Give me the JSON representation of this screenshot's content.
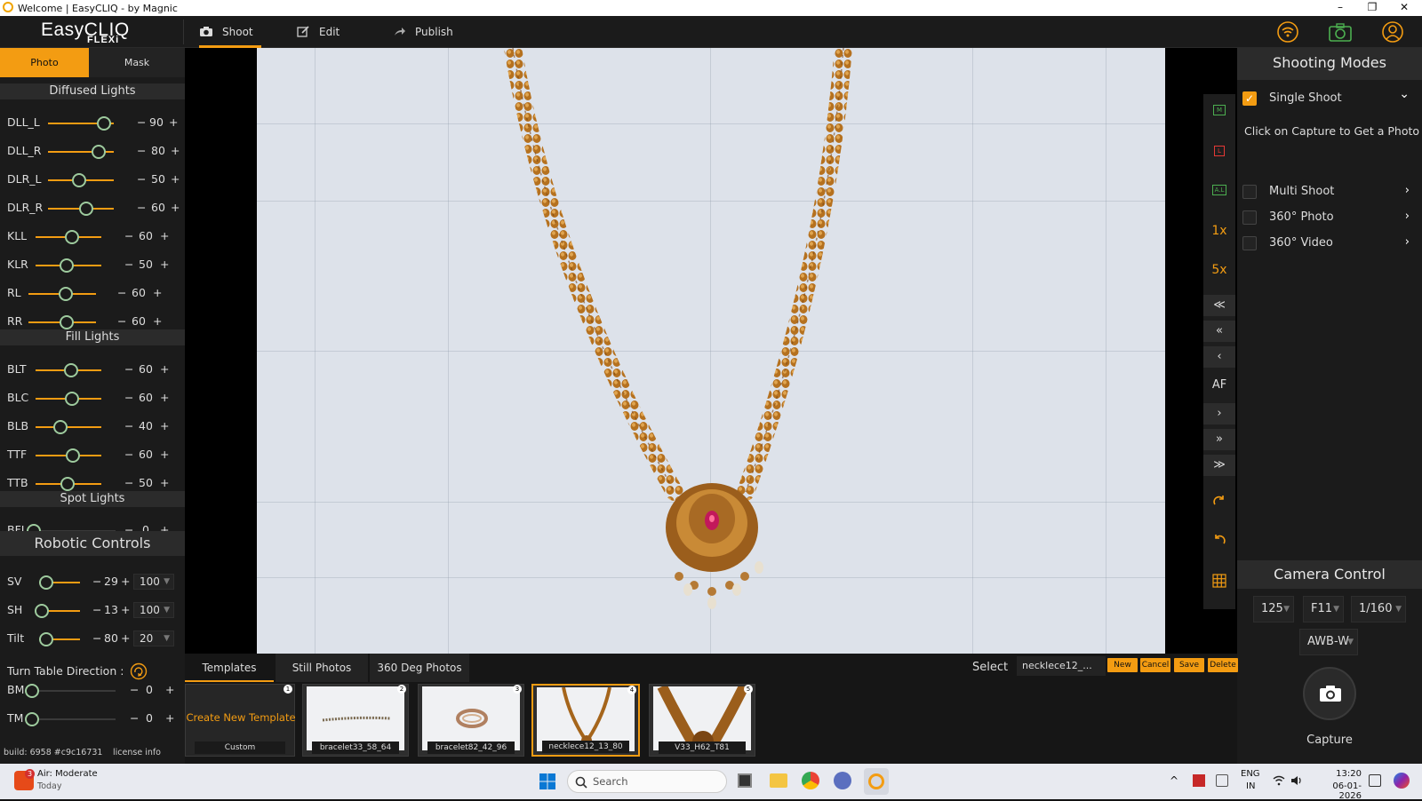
{
  "window": {
    "title": "Welcome | EasyCLIQ - by Magnic",
    "minimize": "–",
    "restore": "❐",
    "close": "✕"
  },
  "brand": {
    "name": "EasyCLIQ",
    "sub": "FLEXi"
  },
  "nav": {
    "tabs": [
      {
        "label": "Shoot",
        "icon": "camera-icon"
      },
      {
        "label": "Edit",
        "icon": "edit-icon"
      },
      {
        "label": "Publish",
        "icon": "share-icon"
      }
    ],
    "active": "Shoot"
  },
  "colors": {
    "accent": "#f39c12",
    "panel": "#1b1b1b",
    "wifi": "#f39c12",
    "camera_status": "#4caf50"
  },
  "left": {
    "tabs": {
      "photo": "Photo",
      "mask": "Mask"
    },
    "diffused": {
      "title": "Diffused Lights",
      "rows": [
        {
          "label": "DLL_L",
          "value": "90",
          "minus": "−",
          "plus": "+"
        },
        {
          "label": "DLL_R",
          "value": "80",
          "minus": "−",
          "plus": "+"
        },
        {
          "label": "DLR_L",
          "value": "50",
          "minus": "−",
          "plus": "+"
        },
        {
          "label": "DLR_R",
          "value": "60",
          "minus": "−",
          "plus": "+"
        },
        {
          "label": "KLL",
          "value": "60",
          "minus": "−",
          "plus": "+"
        },
        {
          "label": "KLR",
          "value": "50",
          "minus": "−",
          "plus": "+"
        },
        {
          "label": "RL",
          "value": "60",
          "minus": "−",
          "plus": "+"
        },
        {
          "label": "RR",
          "value": "60",
          "minus": "−",
          "plus": "+"
        }
      ]
    },
    "fill": {
      "title": "Fill Lights",
      "rows": [
        {
          "label": "BLT",
          "value": "60",
          "minus": "−",
          "plus": "+"
        },
        {
          "label": "BLC",
          "value": "60",
          "minus": "−",
          "plus": "+"
        },
        {
          "label": "BLB",
          "value": "40",
          "minus": "−",
          "plus": "+"
        },
        {
          "label": "TTF",
          "value": "60",
          "minus": "−",
          "plus": "+"
        },
        {
          "label": "TTB",
          "value": "50",
          "minus": "−",
          "plus": "+"
        }
      ]
    },
    "spot": {
      "title": "Spot Lights",
      "rows": [
        {
          "label": "BFL",
          "value": "0",
          "minus": "−",
          "plus": "+"
        }
      ]
    },
    "robotic": {
      "title": "Robotic Controls",
      "rows": [
        {
          "label": "SV",
          "value": "29",
          "speed": "100",
          "minus": "−",
          "plus": "+"
        },
        {
          "label": "SH",
          "value": "13",
          "speed": "100",
          "minus": "−",
          "plus": "+"
        },
        {
          "label": "Tilt",
          "value": "80",
          "speed": "20",
          "minus": "−",
          "plus": "+"
        }
      ],
      "turntable": "Turn Table Direction :",
      "extra": [
        {
          "label": "BM",
          "value": "0",
          "minus": "−",
          "plus": "+"
        },
        {
          "label": "TM",
          "value": "0",
          "minus": "−",
          "plus": "+"
        }
      ]
    },
    "build": "build: 6958 #c9c16731",
    "license": "license info"
  },
  "tools": {
    "m": "M",
    "l": "L",
    "al": "A.L",
    "z1": "1x",
    "z5": "5x",
    "ffl3": "≪",
    "ffl2": "«",
    "fl": "‹",
    "af": "AF",
    "fr": "›",
    "ffr2": "»",
    "ffr3": "≫"
  },
  "right": {
    "shooting_title": "Shooting Modes",
    "single": "Single Shoot",
    "hint": "Click on Capture to Get a Photo",
    "modes": [
      {
        "label": "Multi Shoot"
      },
      {
        "label": "360° Photo"
      },
      {
        "label": "360° Video"
      }
    ],
    "chev": "›",
    "down": "⌄",
    "camera_title": "Camera Control",
    "iso": "125",
    "aperture": "F11",
    "shutter": "1/160",
    "wb": "AWB-W",
    "dd_arrow": "▼",
    "capture": "Capture"
  },
  "bottom": {
    "tabs": [
      "Templates",
      "Still Photos",
      "360 Deg Photos"
    ],
    "select_label": "Select",
    "select_value": "necklece12_...",
    "buttons": [
      "New",
      "Cancel",
      "Save",
      "Delete"
    ],
    "create": "Create New Template",
    "custom": "Custom",
    "thumbs": [
      {
        "cap": "bracelet33_58_64",
        "num": "2"
      },
      {
        "cap": "bracelet82_42_96",
        "num": "3"
      },
      {
        "cap": "necklece12_13_80",
        "num": "4"
      },
      {
        "cap": "V33_H62_T81",
        "num": "5"
      }
    ],
    "first_num": "1"
  },
  "taskbar": {
    "weather": "Air: Moderate",
    "weather_sub": "Today",
    "weather_badge": "3",
    "search": "Search",
    "lang": "ENG",
    "region": "IN",
    "time": "13:20",
    "date": "06-01-2026"
  }
}
